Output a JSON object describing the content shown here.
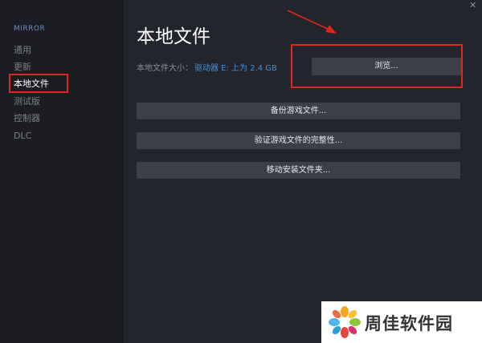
{
  "sidebar": {
    "app_title": "MIRROR",
    "items": [
      {
        "label": "通用",
        "active": false
      },
      {
        "label": "更新",
        "active": false
      },
      {
        "label": "本地文件",
        "active": true
      },
      {
        "label": "测试版",
        "active": false
      },
      {
        "label": "控制器",
        "active": false
      },
      {
        "label": "DLC",
        "active": false
      }
    ]
  },
  "window": {
    "close_icon": "close-icon"
  },
  "main": {
    "title": "本地文件",
    "size_label": "本地文件大小：",
    "size_value": "驱动器 E: 上为 2.4 GB",
    "browse_button": "浏览...",
    "backup_button": "备份游戏文件...",
    "verify_button": "验证游戏文件的完整性...",
    "move_button": "移动安装文件夹..."
  },
  "annotations": {
    "highlight_color": "#e2261f"
  },
  "watermark": {
    "text": "周佳软件园"
  },
  "colors": {
    "sidebar_bg": "#1b1d22",
    "main_bg": "#22252b",
    "button_bg": "#3b3f47",
    "accent_link": "#4c8fd6",
    "sidebar_title": "#6c8ec6"
  }
}
